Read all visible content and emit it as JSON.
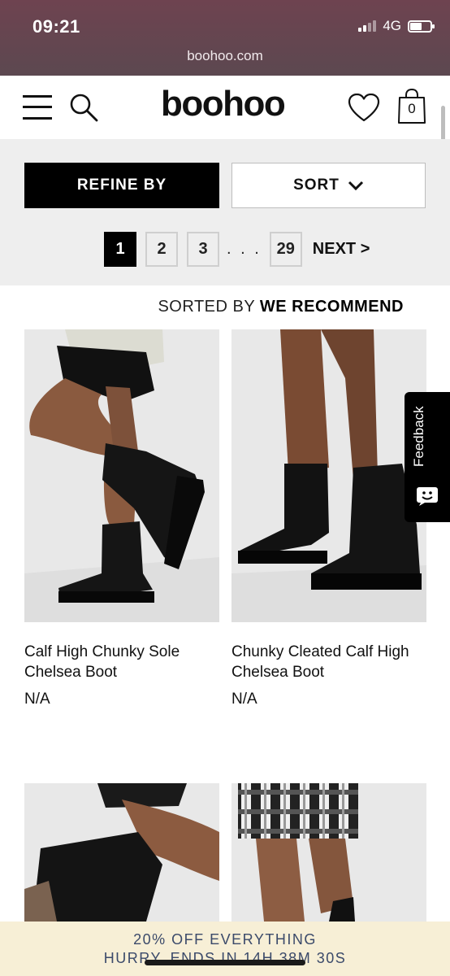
{
  "status_bar": {
    "time": "09:21",
    "network": "4G",
    "battery_level": 0.6
  },
  "browser": {
    "url": "boohoo.com"
  },
  "header": {
    "logo_text": "boohoo",
    "bag_count": "0",
    "icons": [
      "menu-icon",
      "search-icon",
      "heart-icon",
      "bag-icon"
    ]
  },
  "controls": {
    "refine_label": "REFINE BY",
    "sort_label": "SORT",
    "pages": [
      "1",
      "2",
      "3"
    ],
    "ellipsis": ". . .",
    "last_page": "29",
    "next_label": "NEXT >",
    "current_page": "1"
  },
  "sorting": {
    "prefix": "SORTED BY",
    "value": "WE RECOMMEND"
  },
  "products": [
    {
      "name": "Calf High Chunky Sole Chelsea Boot",
      "price": "N/A"
    },
    {
      "name": "Chunky Cleated Calf High Chelsea Boot",
      "price": "N/A"
    },
    {
      "name": "",
      "price": ""
    },
    {
      "name": "",
      "price": ""
    }
  ],
  "feedback": {
    "label": "Feedback"
  },
  "promo": {
    "line1": "20% OFF EVERYTHING",
    "line2": "HURRY, ENDS IN 14H 38M 30S"
  },
  "colors": {
    "browser_bar": "#6e4350",
    "accent": "#000000",
    "promo_bg": "#f7efd6",
    "promo_text": "#3b4a6a"
  }
}
